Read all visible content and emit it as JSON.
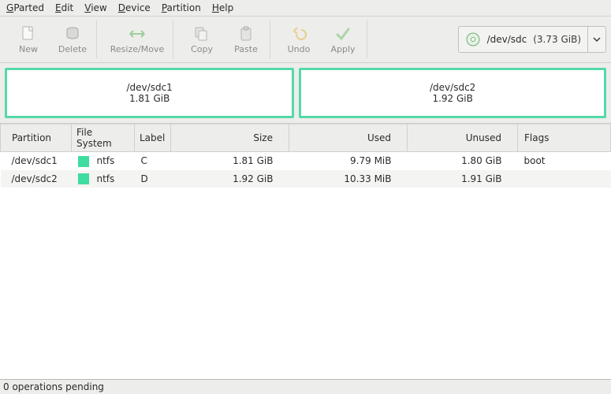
{
  "menu": {
    "gparted": "GParted",
    "edit": "Edit",
    "view": "View",
    "device": "Device",
    "partition": "Partition",
    "help": "Help"
  },
  "toolbar": {
    "new": "New",
    "delete": "Delete",
    "resize": "Resize/Move",
    "copy": "Copy",
    "paste": "Paste",
    "undo": "Undo",
    "apply": "Apply"
  },
  "device_selector": {
    "device": "/dev/sdc",
    "size": "(3.73 GiB)"
  },
  "partmap": [
    {
      "name": "/dev/sdc1",
      "size": "1.81 GiB",
      "frac": 0.485
    },
    {
      "name": "/dev/sdc2",
      "size": "1.92 GiB",
      "frac": 0.515
    }
  ],
  "columns": {
    "partition": "Partition",
    "filesystem": "File System",
    "label": "Label",
    "size": "Size",
    "used": "Used",
    "unused": "Unused",
    "flags": "Flags"
  },
  "rows": [
    {
      "partition": "/dev/sdc1",
      "fs": "ntfs",
      "fs_color": "#3fdca0",
      "label": "C",
      "size": "1.81 GiB",
      "used": "9.79 MiB",
      "unused": "1.80 GiB",
      "flags": "boot"
    },
    {
      "partition": "/dev/sdc2",
      "fs": "ntfs",
      "fs_color": "#3fdca0",
      "label": "D",
      "size": "1.92 GiB",
      "used": "10.33 MiB",
      "unused": "1.91 GiB",
      "flags": ""
    }
  ],
  "status": "0 operations pending"
}
